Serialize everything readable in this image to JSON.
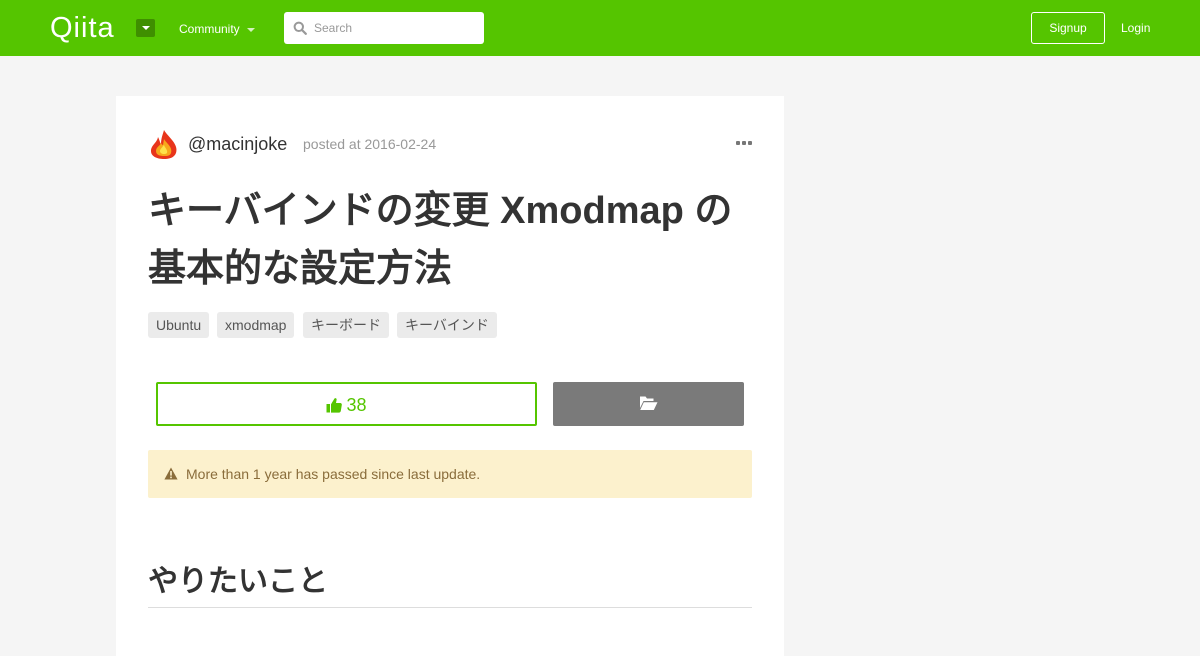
{
  "header": {
    "logo_text": "Qiita",
    "community_label": "Community",
    "search_placeholder": "Search",
    "signup_label": "Signup",
    "login_label": "Login",
    "brand_color": "#55c500"
  },
  "article": {
    "author": "@macinjoke",
    "posted": "posted at 2016-02-24",
    "title": "キーバインドの変更 Xmodmap の基本的な設定方法",
    "tags": [
      "Ubuntu",
      "xmodmap",
      "キーボード",
      "キーバインド"
    ],
    "like_count": "38",
    "alert_text": "More than 1 year has passed since last update.",
    "section_heading": "やりたいこと"
  },
  "icons": {
    "like": "thumbs-up-icon",
    "stock": "folder-open-icon",
    "alert": "warning-icon",
    "search": "search-icon",
    "menu": "ellipsis-icon"
  }
}
